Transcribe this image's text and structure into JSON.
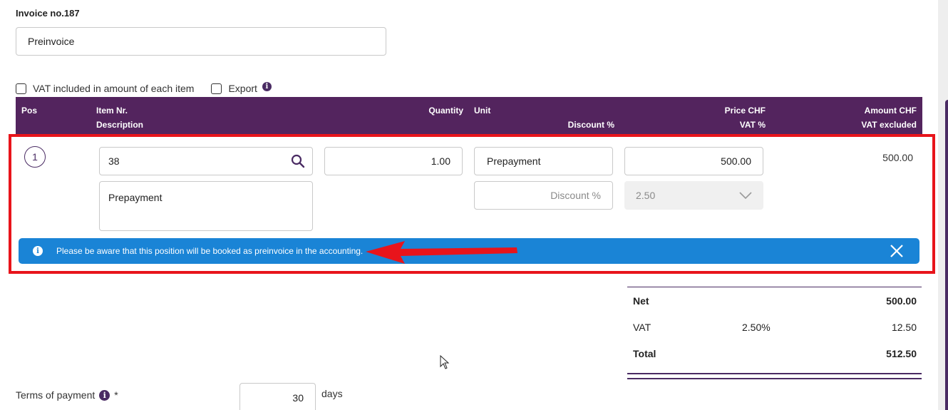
{
  "invoice": {
    "label": "Invoice no.187",
    "title_value": "Preinvoice"
  },
  "options": {
    "vat_included_label": "VAT included in amount of each item",
    "export_label": "Export",
    "info_glyph": "i"
  },
  "table_header": {
    "pos": "Pos",
    "item_nr": "Item Nr.",
    "description": "Description",
    "quantity": "Quantity",
    "unit": "Unit",
    "discount": "Discount %",
    "price": "Price CHF",
    "vat": "VAT %",
    "amount": "Amount CHF",
    "vat_excluded": "VAT excluded"
  },
  "row": {
    "position": "1",
    "item_nr": "38",
    "description": "Prepayment",
    "quantity": "1.00",
    "unit": "Prepayment",
    "discount_placeholder": "Discount %",
    "price": "500.00",
    "vat": "2.50",
    "amount": "500.00"
  },
  "alert": {
    "message": "Please be aware that this position will be booked as preinvoice in the accounting.",
    "info_glyph": "i"
  },
  "totals": {
    "net_label": "Net",
    "net_value": "500.00",
    "vat_label": "VAT",
    "vat_rate": "2.50%",
    "vat_value": "12.50",
    "total_label": "Total",
    "total_value": "512.50"
  },
  "terms": {
    "label": "Terms of payment",
    "required_mark": "*",
    "value": "30",
    "unit": "days",
    "info_glyph": "i"
  },
  "colors": {
    "header_bg": "#53245e",
    "alert_bg": "#1a84d6",
    "highlight": "#e8141b",
    "accent": "#4a2b63"
  }
}
